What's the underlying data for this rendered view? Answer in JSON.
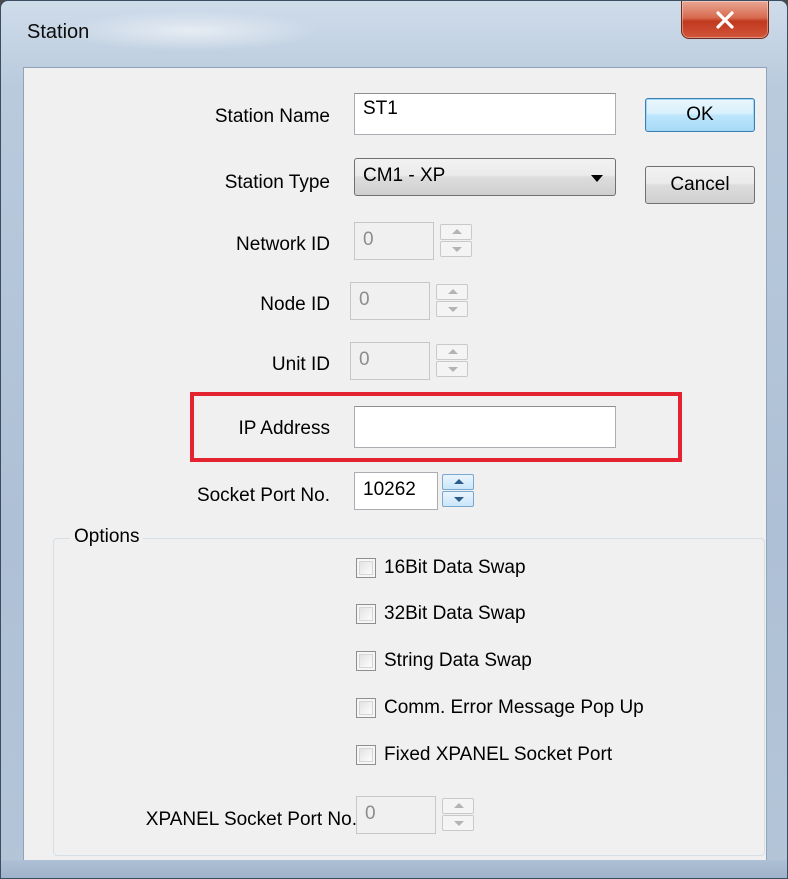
{
  "window": {
    "title": "Station",
    "close_icon": "close-x-icon"
  },
  "form": {
    "station_name_label": "Station Name",
    "station_name_value": "ST1",
    "station_type_label": "Station Type",
    "station_type_value": "CM1 - XP",
    "network_id_label": "Network ID",
    "network_id_value": "0",
    "node_id_label": "Node ID",
    "node_id_value": "0",
    "unit_id_label": "Unit ID",
    "unit_id_value": "0",
    "ip_address_label": "IP Address",
    "ip_address_value": "",
    "socket_port_label": "Socket Port No.",
    "socket_port_value": "10262",
    "xpanel_port_label": "XPANEL Socket Port No.",
    "xpanel_port_value": "0"
  },
  "buttons": {
    "ok": "OK",
    "cancel": "Cancel"
  },
  "options": {
    "legend": "Options",
    "items": [
      {
        "label": "16Bit Data Swap",
        "checked": false
      },
      {
        "label": "32Bit Data Swap",
        "checked": false
      },
      {
        "label": "String Data Swap",
        "checked": false
      },
      {
        "label": "Comm. Error Message Pop Up",
        "checked": false
      },
      {
        "label": "Fixed XPANEL Socket Port",
        "checked": false
      }
    ]
  },
  "annotation": {
    "highlight_color": "#e3232f"
  }
}
